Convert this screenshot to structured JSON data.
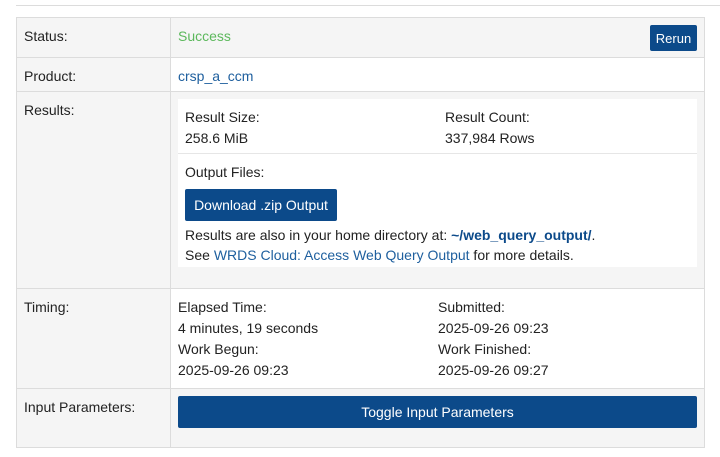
{
  "status": {
    "label": "Status:",
    "value": "Success",
    "rerun_label": "Rerun"
  },
  "product": {
    "label": "Product:",
    "value": "crsp_a_ccm"
  },
  "results": {
    "label": "Results:",
    "size_label": "Result Size:",
    "size_value": "258.6 MiB",
    "count_label": "Result Count:",
    "count_value": "337,984 Rows",
    "output_files_label": "Output Files:",
    "download_label": "Download .zip Output",
    "home_text": "Results are also in your home directory at: ",
    "home_path": "~/web_query_output/",
    "home_suffix": ".",
    "see_prefix": "See ",
    "see_link": "WRDS Cloud: Access Web Query Output",
    "see_suffix": " for more details."
  },
  "timing": {
    "label": "Timing:",
    "elapsed_label": "Elapsed Time:",
    "elapsed_value": "4 minutes, 19 seconds",
    "submitted_label": "Submitted:",
    "submitted_value": "2025-09-26 09:23",
    "begun_label": "Work Begun:",
    "begun_value": "2025-09-26 09:23",
    "finished_label": "Work Finished:",
    "finished_value": "2025-09-26 09:27"
  },
  "input_parameters": {
    "label": "Input Parameters:",
    "toggle_label": "Toggle Input Parameters"
  }
}
